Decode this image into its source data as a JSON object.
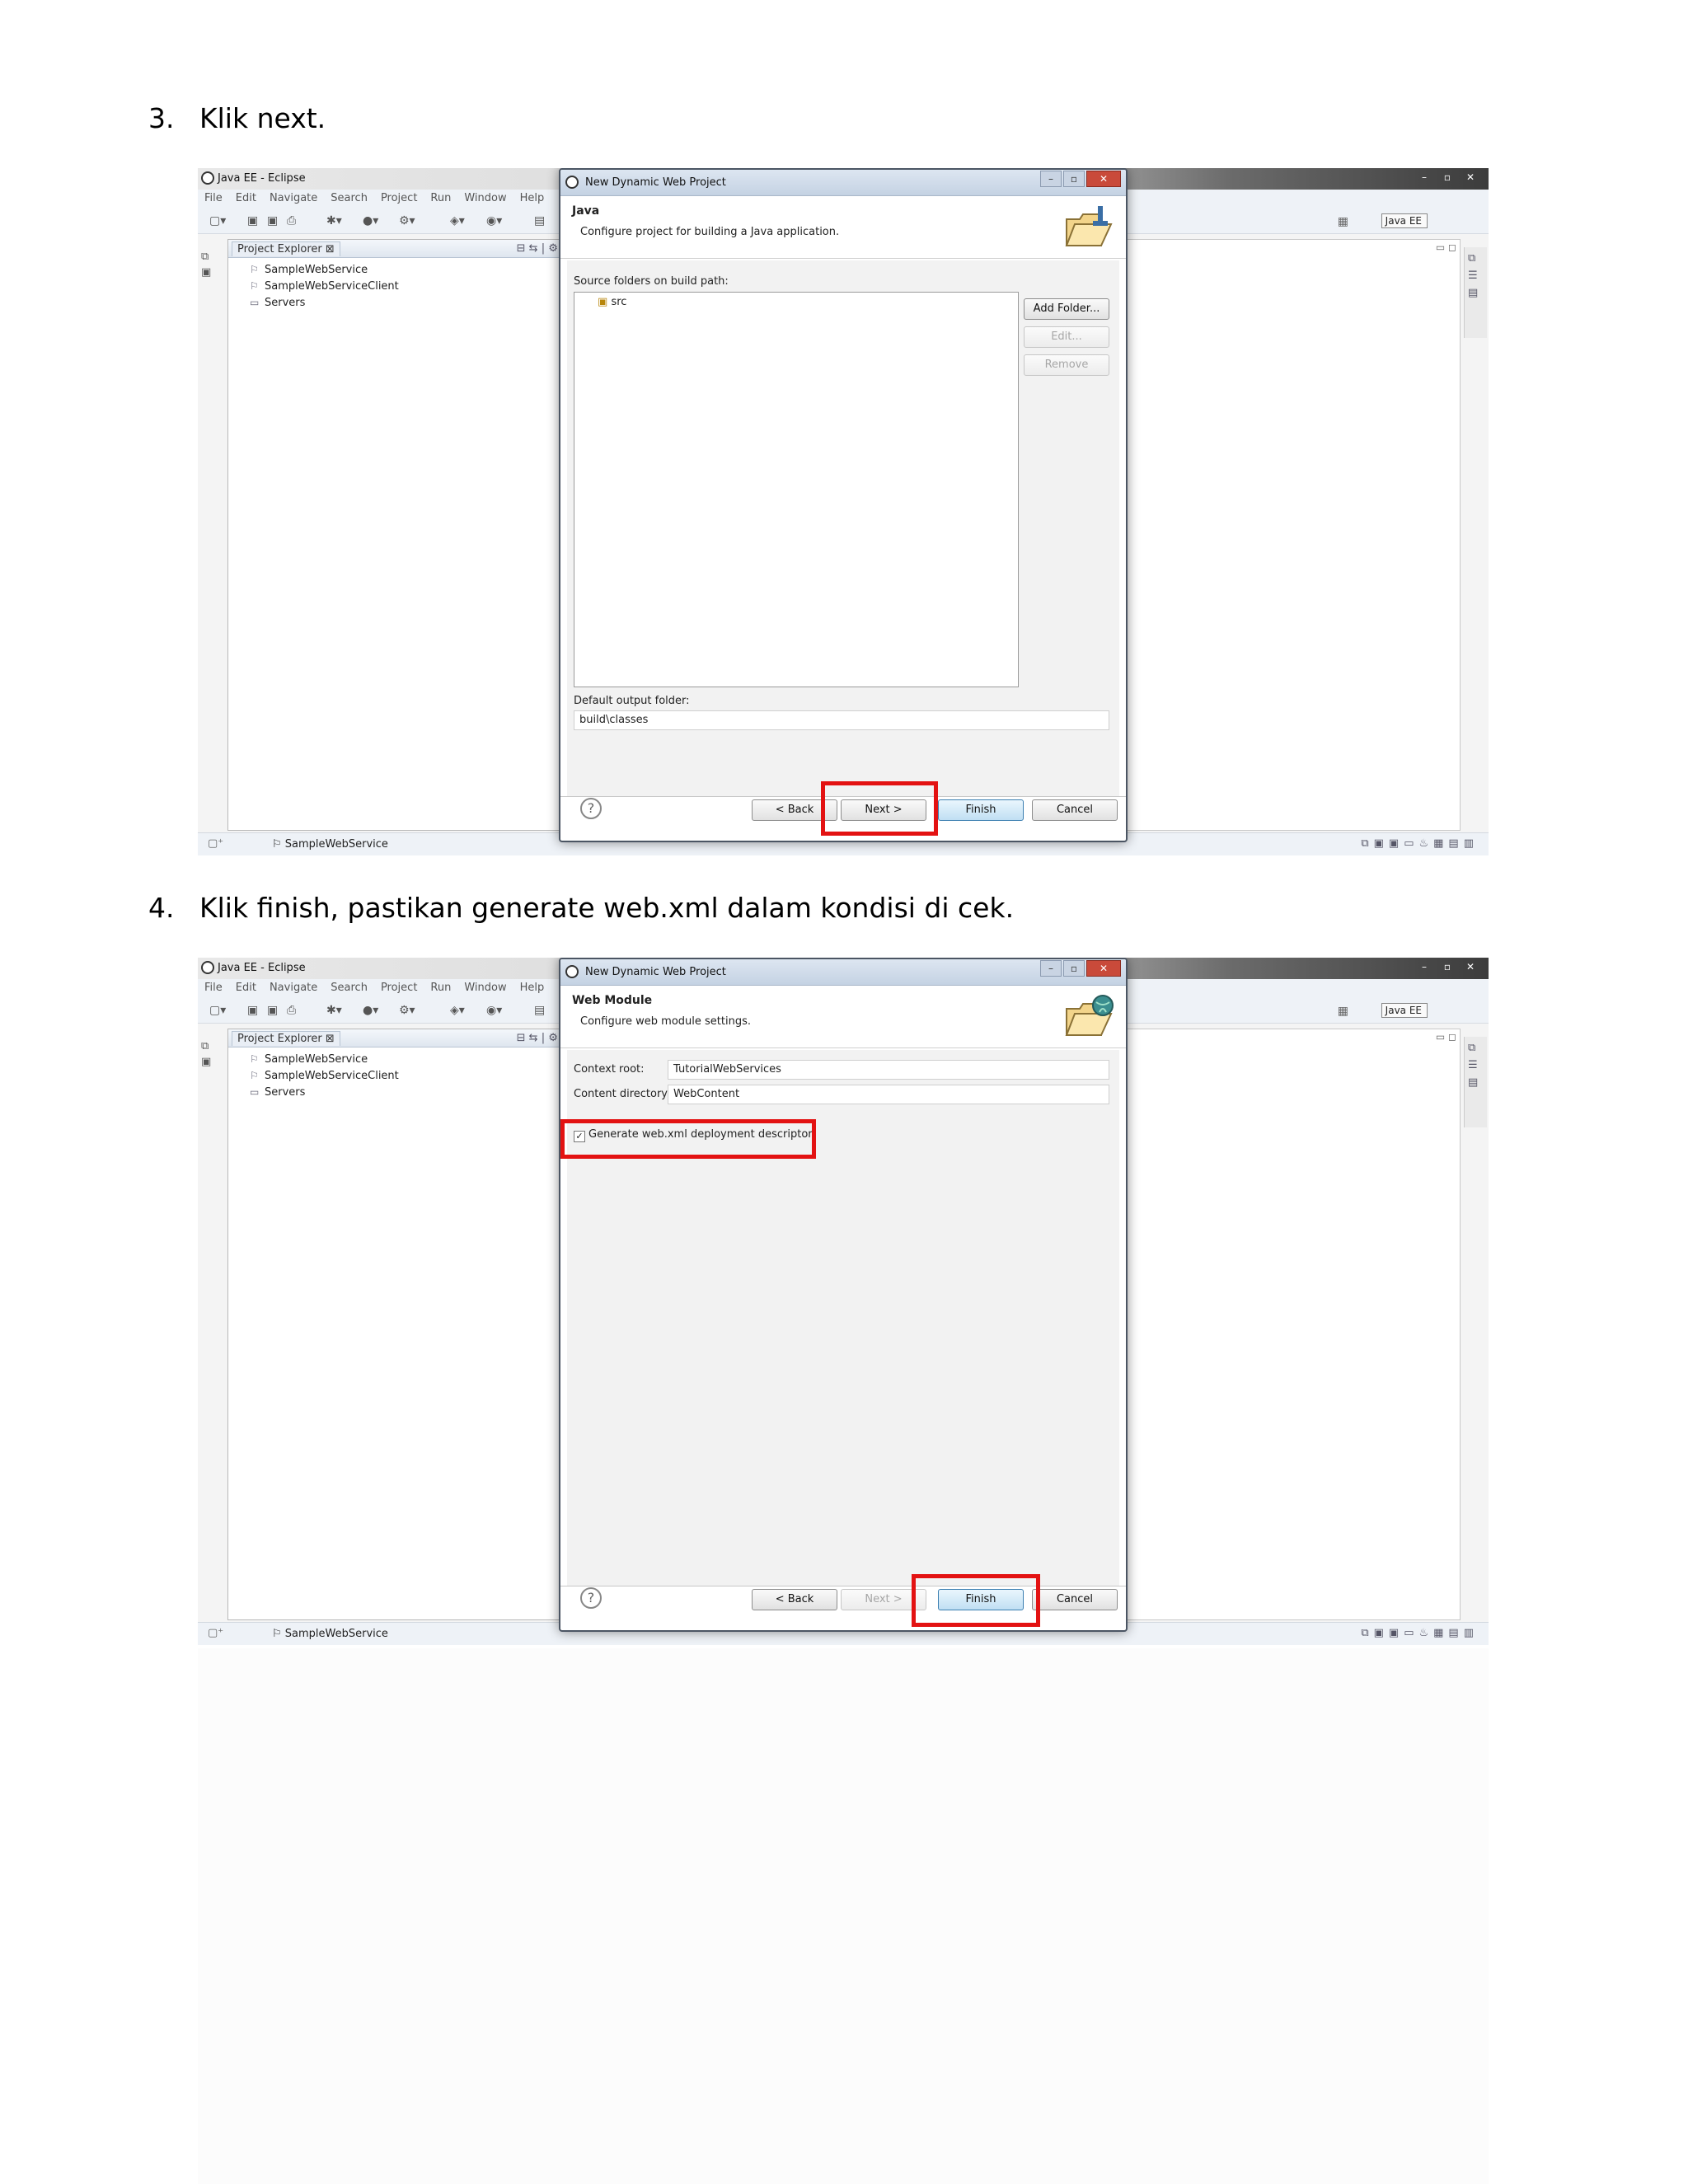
{
  "steps": [
    {
      "number": "3.",
      "text": "Klik next.",
      "eclipse": {
        "window_title": "Java EE - Eclipse",
        "menu": [
          "File",
          "Edit",
          "Navigate",
          "Search",
          "Project",
          "Run",
          "Window",
          "Help"
        ],
        "explorer_tab": "Project Explorer",
        "tree": [
          "SampleWebService",
          "SampleWebServiceClient",
          "Servers"
        ],
        "perspective": "Java EE",
        "status_project": "SampleWebService"
      },
      "dialog": {
        "title": "New Dynamic Web Project",
        "heading": "Java",
        "description": "Configure project for building a Java application.",
        "source_label": "Source folders on build path:",
        "source_items": [
          "src"
        ],
        "add_folder": "Add Folder...",
        "edit": "Edit...",
        "remove": "Remove",
        "output_label": "Default output folder:",
        "output_value": "build\\classes",
        "back": "< Back",
        "next": "Next >",
        "finish": "Finish",
        "cancel": "Cancel"
      }
    },
    {
      "number": "4.",
      "text": "Klik finish, pastikan generate web.xml dalam kondisi di cek.",
      "eclipse": {
        "window_title": "Java EE - Eclipse",
        "menu": [
          "File",
          "Edit",
          "Navigate",
          "Search",
          "Project",
          "Run",
          "Window",
          "Help"
        ],
        "explorer_tab": "Project Explorer",
        "tree": [
          "SampleWebService",
          "SampleWebServiceClient",
          "Servers"
        ],
        "perspective": "Java EE",
        "status_project": "SampleWebService"
      },
      "dialog": {
        "title": "New Dynamic Web Project",
        "heading": "Web Module",
        "description": "Configure web module settings.",
        "context_root_label": "Context root:",
        "context_root_value": "TutorialWebServices",
        "content_dir_label": "Content directory:",
        "content_dir_value": "WebContent",
        "generate_label": "Generate web.xml deployment descriptor",
        "generate_checked": true,
        "back": "< Back",
        "next": "Next >",
        "finish": "Finish",
        "cancel": "Cancel"
      }
    }
  ],
  "colors": {
    "highlight": "#e31212"
  }
}
